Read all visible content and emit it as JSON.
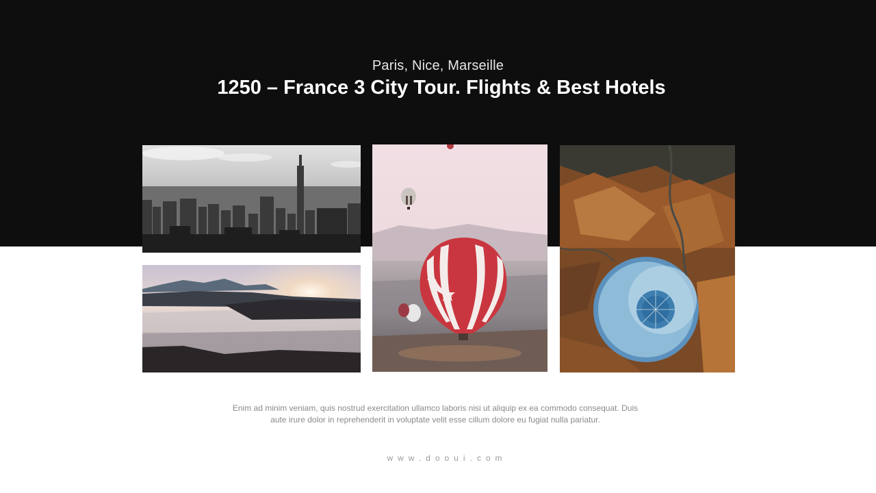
{
  "header": {
    "subtitle": "Paris, Nice, Marseille",
    "title": "1250 – France 3 City Tour. Flights & Best Hotels",
    "background": "#0e0e0e"
  },
  "gallery": {
    "photos": [
      {
        "name": "city-skyline-photo",
        "subject": "black and white city skyline"
      },
      {
        "name": "misty-sunrise-photo",
        "subject": "misty mountain valley at sunrise"
      },
      {
        "name": "hot-air-balloon-photo",
        "subject": "red and white hot air balloon over valley"
      },
      {
        "name": "aerial-balloon-photo",
        "subject": "blue hot air balloon over brown fields, aerial view"
      }
    ]
  },
  "body": {
    "text": "Enim ad minim veniam, quis nostrud exercitation ullamco laboris nisi ut aliquip ex ea commodo consequat. Duis aute irure dolor in reprehenderit in voluptate velit esse cillum dolore eu fugiat nulla pariatur."
  },
  "footer": {
    "website": "www.dooui.com"
  }
}
